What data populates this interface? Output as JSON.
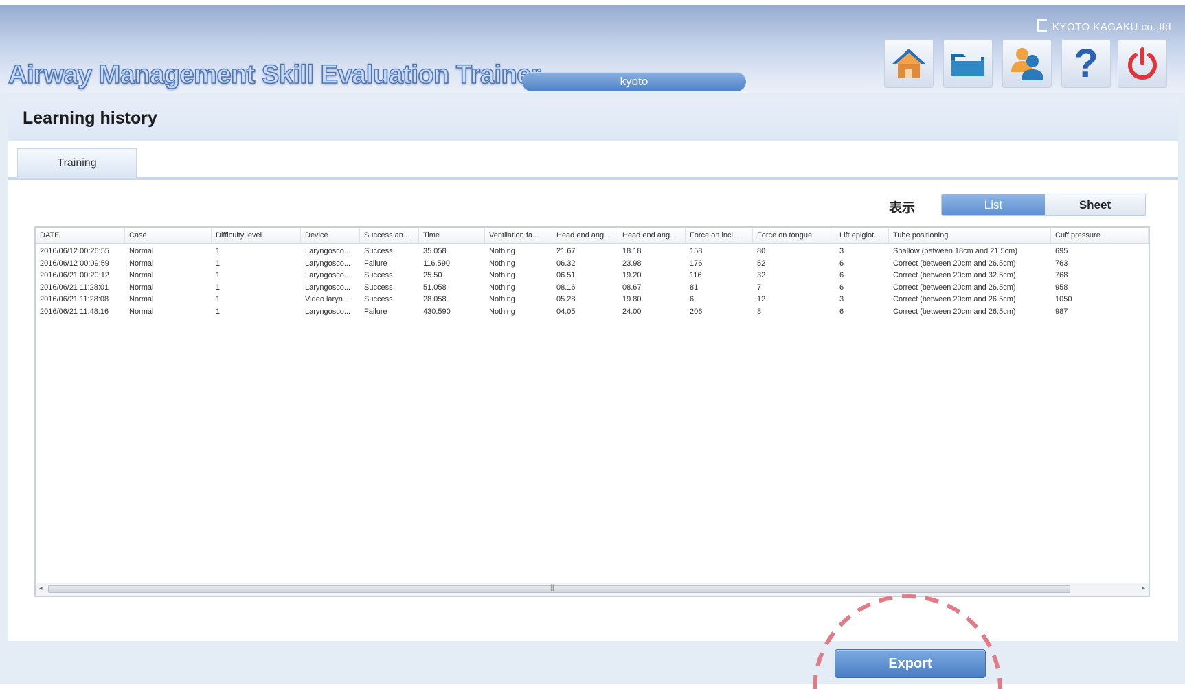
{
  "app": {
    "title": "Airway Management Skill Evaluation Trainer",
    "brand": "KYOTO KAGAKU co.,ltd",
    "user": "kyoto"
  },
  "toolbar": {
    "home_icon": "home-icon",
    "folder_icon": "folder-icon",
    "users_icon": "users-icon",
    "help_icon": "help-icon",
    "power_icon": "power-icon",
    "help_glyph": "?"
  },
  "page": {
    "title": "Learning history",
    "tabs": [
      {
        "label": "Training"
      }
    ],
    "view_label": "表示",
    "view_options": {
      "list": "List",
      "sheet": "Sheet"
    },
    "export_label": "Export"
  },
  "table": {
    "columns": [
      "DATE",
      "Case",
      "Difficulty level",
      "Device",
      "Success an...",
      "Time",
      "Ventilation fa...",
      "Head end ang...",
      "Head end ang...",
      "Force on inci...",
      "Force on tongue",
      "Lift epiglot...",
      "Tube positioning",
      "Cuff pressure"
    ],
    "rows": [
      [
        "2016/06/12 00:26:55",
        "Normal",
        "1",
        "Laryngosco...",
        "Success",
        "35.058",
        "Nothing",
        "21.67",
        "18.18",
        "158",
        "80",
        "3",
        "Shallow (between 18cm and 21.5cm)",
        "695"
      ],
      [
        "2016/06/12 00:09:59",
        "Normal",
        "1",
        "Laryngosco...",
        "Failure",
        "116.590",
        "Nothing",
        "06.32",
        "23.98",
        "176",
        "52",
        "6",
        "Correct (between 20cm and 26.5cm)",
        "763"
      ],
      [
        "2016/06/21 00:20:12",
        "Normal",
        "1",
        "Laryngosco...",
        "Success",
        "25.50",
        "Nothing",
        "06.51",
        "19.20",
        "116",
        "32",
        "6",
        "Correct (between 20cm and 32.5cm)",
        "768"
      ],
      [
        "2016/06/21 11:28:01",
        "Normal",
        "1",
        "Laryngosco...",
        "Success",
        "51.058",
        "Nothing",
        "08.16",
        "08.67",
        "81",
        "7",
        "6",
        "Correct (between 20cm and 26.5cm)",
        "958"
      ],
      [
        "2016/06/21 11:28:08",
        "Normal",
        "1",
        "Video laryn...",
        "Success",
        "28.058",
        "Nothing",
        "05.28",
        "19.80",
        "6",
        "12",
        "3",
        "Correct (between 20cm and 26.5cm)",
        "1050"
      ],
      [
        "2016/06/21 11:48:16",
        "Normal",
        "1",
        "Laryngosco...",
        "Failure",
        "430.590",
        "Nothing",
        "04.05",
        "24.00",
        "206",
        "8",
        "6",
        "Correct (between 20cm and 26.5cm)",
        "987"
      ]
    ]
  },
  "scrollbar": {
    "left_arrow": "◂",
    "right_arrow": "▸",
    "grip": "|||"
  },
  "colors": {
    "accent": "#5b8dd0",
    "power": "#e0353a",
    "callout": "#e27b86"
  }
}
